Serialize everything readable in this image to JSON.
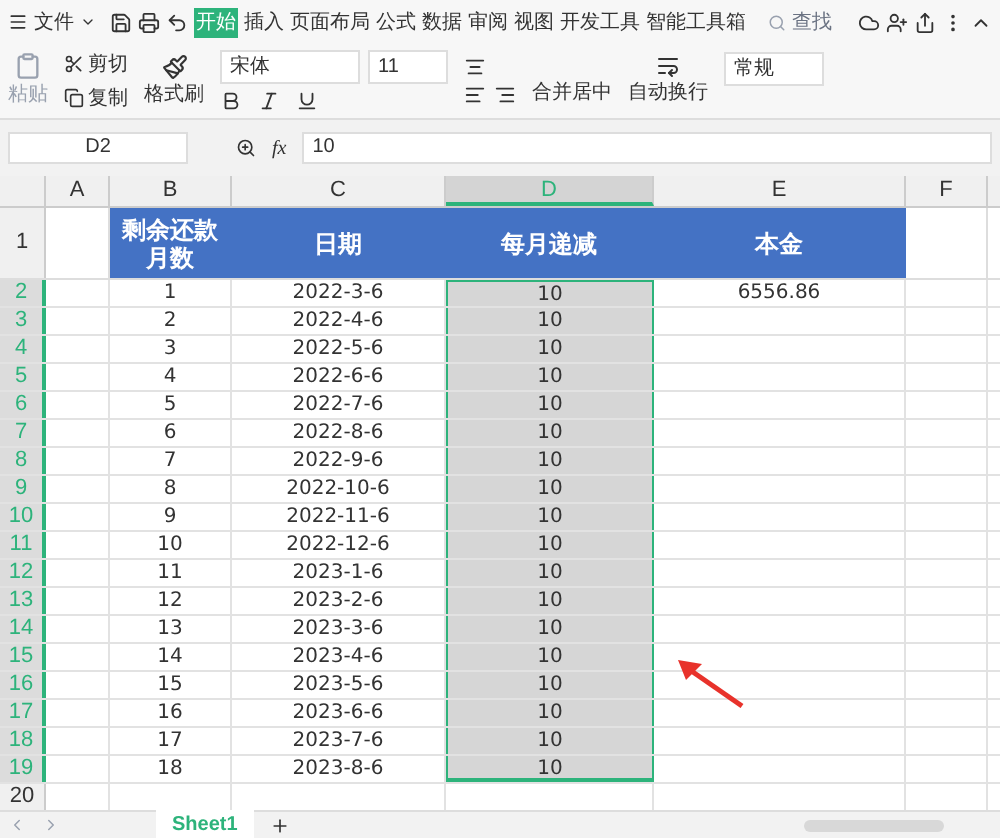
{
  "menu": {
    "file": "文件",
    "tabs": [
      {
        "label": "开始",
        "selected": true
      },
      {
        "label": "插入",
        "selected": false
      },
      {
        "label": "页面布局",
        "selected": false
      },
      {
        "label": "公式",
        "selected": false
      },
      {
        "label": "数据",
        "selected": false
      },
      {
        "label": "审阅",
        "selected": false
      },
      {
        "label": "视图",
        "selected": false
      },
      {
        "label": "开发工具",
        "selected": false
      },
      {
        "label": "智能工具箱",
        "selected": false
      }
    ],
    "search": "查找"
  },
  "ribbon": {
    "paste": "粘贴",
    "cut": "剪切",
    "copy": "复制",
    "format_painter": "格式刷",
    "font": "宋体",
    "font_size": "11",
    "merge": "合并居中",
    "wrap": "自动换行",
    "number_format": "常规"
  },
  "formula_bar": {
    "cell_ref": "D2",
    "fx": "fx",
    "value": "10"
  },
  "columns": [
    {
      "label": "A",
      "selected": false
    },
    {
      "label": "B",
      "selected": false
    },
    {
      "label": "C",
      "selected": false
    },
    {
      "label": "D",
      "selected": true
    },
    {
      "label": "E",
      "selected": false
    },
    {
      "label": "F",
      "selected": false
    }
  ],
  "header_row": {
    "number": "1",
    "cells": [
      "",
      "剩余还款月数",
      "日期",
      "每月递减",
      "本金",
      ""
    ]
  },
  "rows": [
    {
      "number": "2",
      "selected": true,
      "cells": [
        "",
        "1",
        "2022-3-6",
        "10",
        "6556.86",
        ""
      ]
    },
    {
      "number": "3",
      "selected": true,
      "cells": [
        "",
        "2",
        "2022-4-6",
        "10",
        "",
        ""
      ]
    },
    {
      "number": "4",
      "selected": true,
      "cells": [
        "",
        "3",
        "2022-5-6",
        "10",
        "",
        ""
      ]
    },
    {
      "number": "5",
      "selected": true,
      "cells": [
        "",
        "4",
        "2022-6-6",
        "10",
        "",
        ""
      ]
    },
    {
      "number": "6",
      "selected": true,
      "cells": [
        "",
        "5",
        "2022-7-6",
        "10",
        "",
        ""
      ]
    },
    {
      "number": "7",
      "selected": true,
      "cells": [
        "",
        "6",
        "2022-8-6",
        "10",
        "",
        ""
      ]
    },
    {
      "number": "8",
      "selected": true,
      "cells": [
        "",
        "7",
        "2022-9-6",
        "10",
        "",
        ""
      ]
    },
    {
      "number": "9",
      "selected": true,
      "cells": [
        "",
        "8",
        "2022-10-6",
        "10",
        "",
        ""
      ]
    },
    {
      "number": "10",
      "selected": true,
      "cells": [
        "",
        "9",
        "2022-11-6",
        "10",
        "",
        ""
      ]
    },
    {
      "number": "11",
      "selected": true,
      "cells": [
        "",
        "10",
        "2022-12-6",
        "10",
        "",
        ""
      ]
    },
    {
      "number": "12",
      "selected": true,
      "cells": [
        "",
        "11",
        "2023-1-6",
        "10",
        "",
        ""
      ]
    },
    {
      "number": "13",
      "selected": true,
      "cells": [
        "",
        "12",
        "2023-2-6",
        "10",
        "",
        ""
      ]
    },
    {
      "number": "14",
      "selected": true,
      "cells": [
        "",
        "13",
        "2023-3-6",
        "10",
        "",
        ""
      ]
    },
    {
      "number": "15",
      "selected": true,
      "cells": [
        "",
        "14",
        "2023-4-6",
        "10",
        "",
        ""
      ]
    },
    {
      "number": "16",
      "selected": true,
      "cells": [
        "",
        "15",
        "2023-5-6",
        "10",
        "",
        ""
      ]
    },
    {
      "number": "17",
      "selected": true,
      "cells": [
        "",
        "16",
        "2023-6-6",
        "10",
        "",
        ""
      ]
    },
    {
      "number": "18",
      "selected": true,
      "cells": [
        "",
        "17",
        "2023-7-6",
        "10",
        "",
        ""
      ]
    },
    {
      "number": "19",
      "selected": true,
      "cells": [
        "",
        "18",
        "2023-8-6",
        "10",
        "",
        ""
      ]
    },
    {
      "number": "20",
      "selected": false,
      "cells": [
        "",
        "",
        "",
        "",
        "",
        ""
      ]
    }
  ],
  "sheets": [
    {
      "label": "Sheet1",
      "selected": true
    }
  ]
}
